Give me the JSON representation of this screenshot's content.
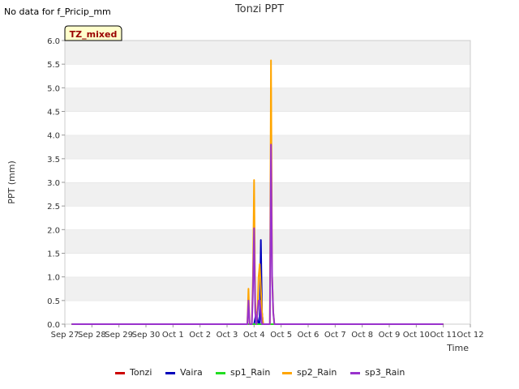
{
  "header": {
    "no_data_note": "No data for f_Pricip_mm",
    "badge": "TZ_mixed"
  },
  "chart_data": {
    "type": "line",
    "title": "Tonzi PPT",
    "xlabel": "Time",
    "ylabel": "PPT (mm)",
    "ylim": [
      0,
      6.0
    ],
    "yticks": [
      "0.0",
      "0.5",
      "1.0",
      "1.5",
      "2.0",
      "2.5",
      "3.0",
      "3.5",
      "4.0",
      "4.5",
      "5.0",
      "5.5",
      "6.0"
    ],
    "xlim": [
      "2024-09-27",
      "2024-10-12"
    ],
    "x_tick_labels": [
      "Sep 27",
      "Sep 28",
      "Sep 29",
      "Sep 30",
      "Oct 1",
      "Oct 2",
      "Oct 3",
      "Oct 4",
      "Oct 5",
      "Oct 6",
      "Oct 7",
      "Oct 8",
      "Oct 9",
      "Oct 10",
      "Oct 11",
      "Oct 12"
    ],
    "grid": "horizontal bands",
    "legend_position": "bottom",
    "series": [
      {
        "name": "Tonzi",
        "color": "#cc0000",
        "x": [
          "2024-09-27T06:00",
          "2024-10-11T00:00"
        ],
        "y": [
          0,
          0
        ]
      },
      {
        "name": "Vaira",
        "color": "#0000bb",
        "x": [
          "2024-09-27T06:00",
          "2024-10-04T00:00",
          "2024-10-04T02:00",
          "2024-10-04T04:00",
          "2024-10-04T05:00",
          "2024-10-04T06:00",
          "2024-10-04T07:00",
          "2024-10-04T08:00",
          "2024-10-04T10:00",
          "2024-10-11T00:00"
        ],
        "y": [
          0,
          0,
          0.25,
          0,
          0,
          1.78,
          0.25,
          0,
          0,
          0
        ]
      },
      {
        "name": "sp1_Rain",
        "color": "#22dd22",
        "x": [
          "2024-09-27T06:00",
          "2024-10-11T00:00"
        ],
        "y": [
          0,
          0
        ]
      },
      {
        "name": "sp2_Rain",
        "color": "#ffa500",
        "x": [
          "2024-09-27T06:00",
          "2024-10-03T18:00",
          "2024-10-03T19:00",
          "2024-10-03T20:00",
          "2024-10-03T22:00",
          "2024-10-03T23:00",
          "2024-10-04T00:00",
          "2024-10-04T01:00",
          "2024-10-04T02:00",
          "2024-10-04T03:00",
          "2024-10-04T04:00",
          "2024-10-04T05:00",
          "2024-10-04T06:00",
          "2024-10-04T07:00",
          "2024-10-04T08:00",
          "2024-10-04T09:00",
          "2024-10-04T14:00",
          "2024-10-04T15:00",
          "2024-10-04T16:00",
          "2024-10-04T17:00",
          "2024-10-04T18:00",
          "2024-10-11T00:00"
        ],
        "y": [
          0,
          0,
          0.75,
          0,
          0,
          1.0,
          3.05,
          0.5,
          0,
          0.25,
          1.0,
          1.27,
          0.75,
          0.25,
          0,
          0,
          0,
          5.58,
          1.0,
          0.25,
          0,
          0
        ]
      },
      {
        "name": "sp3_Rain",
        "color": "#9933cc",
        "x": [
          "2024-09-27T06:00",
          "2024-10-03T18:00",
          "2024-10-03T19:00",
          "2024-10-03T20:00",
          "2024-10-03T22:00",
          "2024-10-03T23:00",
          "2024-10-04T00:00",
          "2024-10-04T01:00",
          "2024-10-04T02:00",
          "2024-10-04T03:00",
          "2024-10-04T04:00",
          "2024-10-04T05:00",
          "2024-10-04T06:00",
          "2024-10-04T07:00",
          "2024-10-04T08:00",
          "2024-10-04T09:00",
          "2024-10-04T14:00",
          "2024-10-04T15:00",
          "2024-10-04T16:00",
          "2024-10-04T17:00",
          "2024-10-04T18:00",
          "2024-10-11T00:00"
        ],
        "y": [
          0,
          0,
          0.5,
          0,
          0,
          0.75,
          2.03,
          0.25,
          0,
          0.25,
          0.5,
          0.5,
          0.25,
          0,
          0,
          0,
          0,
          3.8,
          1.0,
          0.25,
          0,
          0
        ]
      }
    ]
  }
}
